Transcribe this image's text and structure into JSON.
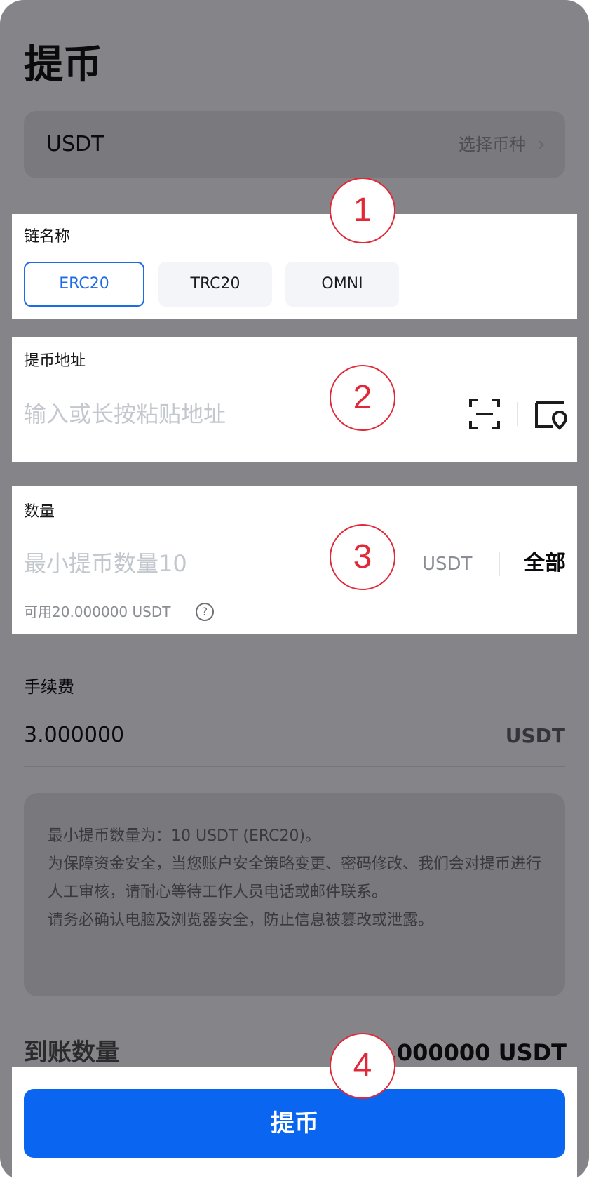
{
  "page": {
    "title": "提币"
  },
  "coin": {
    "name": "USDT",
    "select_label": "选择币种"
  },
  "chain": {
    "label": "链名称",
    "options": [
      {
        "label": "ERC20",
        "selected": true
      },
      {
        "label": "TRC20",
        "selected": false
      },
      {
        "label": "OMNI",
        "selected": false
      }
    ]
  },
  "address": {
    "label": "提币地址",
    "placeholder": "输入或长按粘贴地址"
  },
  "amount": {
    "label": "数量",
    "placeholder": "最小提币数量10",
    "unit": "USDT",
    "all_label": "全部",
    "available": "可用20.000000 USDT"
  },
  "fee": {
    "label": "手续费",
    "value": "3.000000",
    "unit": "USDT"
  },
  "notice": {
    "lines": [
      "最小提币数量为：10 USDT (ERC20)。",
      "为保障资金安全，当您账户安全策略变更、密码修改、我们会对提币进行人工审核，请耐心等待工作人员电话或邮件联系。",
      "请务必确认电脑及浏览器安全，防止信息被篡改或泄露。"
    ]
  },
  "receive": {
    "label": "到账数量",
    "value": "0.000000 USDT"
  },
  "submit": {
    "label": "提币"
  },
  "annotations": [
    "1",
    "2",
    "3",
    "4"
  ],
  "colors": {
    "accent": "#0a66f0",
    "badge": "#e12838",
    "overlay": "#858589"
  }
}
